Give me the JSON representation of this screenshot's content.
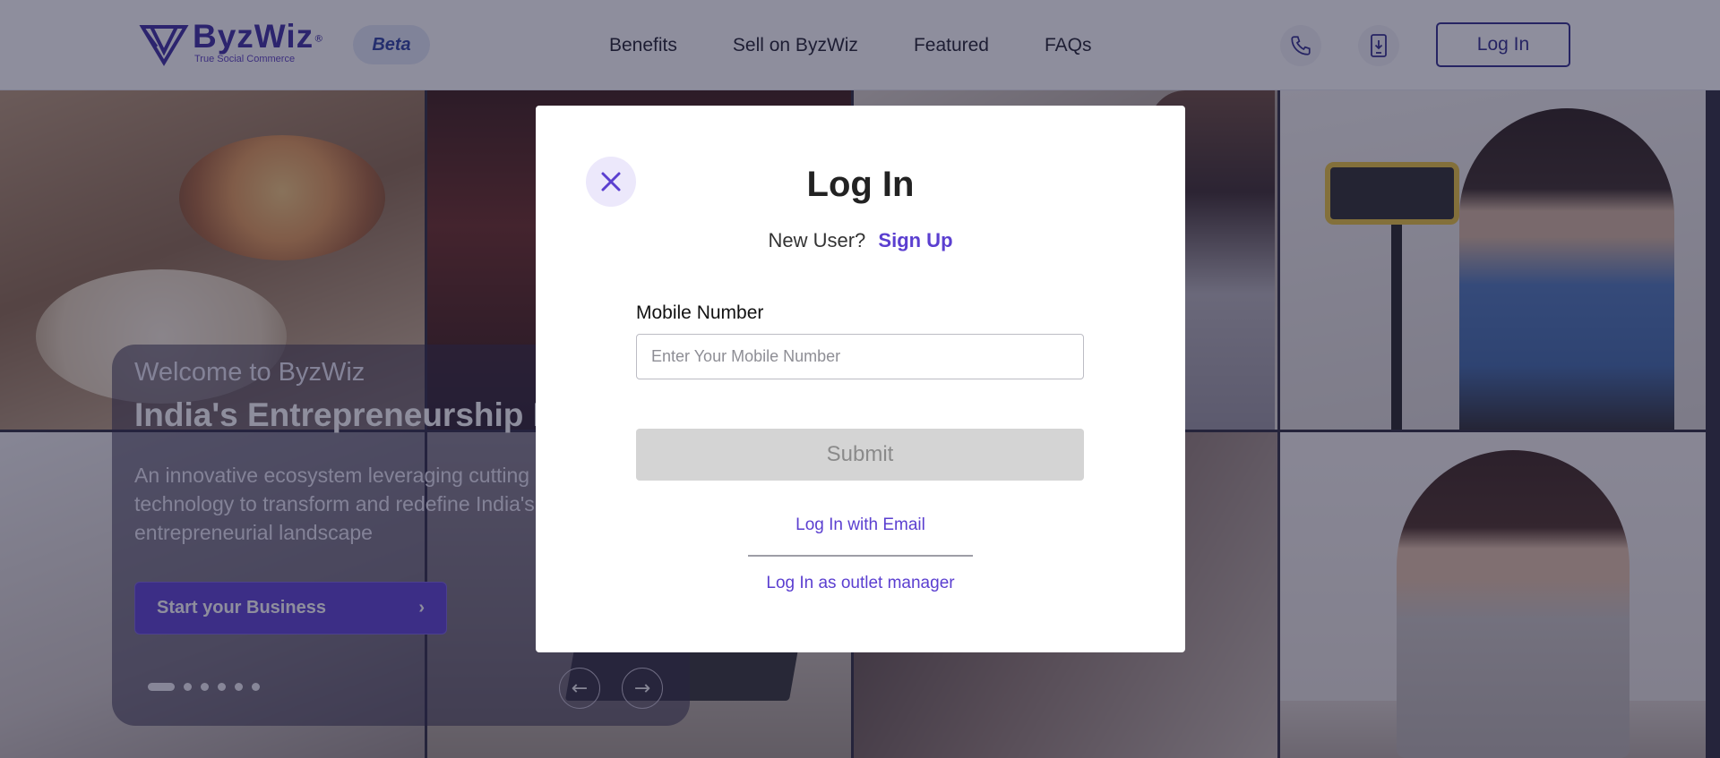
{
  "header": {
    "logo_name": "ByzWiz",
    "logo_reg": "®",
    "logo_tagline": "True Social Commerce",
    "beta_label": "Beta",
    "nav": [
      "Benefits",
      "Sell on ByzWiz",
      "Featured",
      "FAQs"
    ],
    "phone_icon": "phone-icon",
    "app_icon": "mobile-download-icon",
    "login_label": "Log In"
  },
  "hero": {
    "welcome": "Welcome to ByzWiz",
    "title": "India's Entrepreneurship I",
    "description": "An innovative ecosystem leveraging cutting technology to transform and redefine India's entrepreneurial landscape",
    "cta_label": "Start your Business",
    "cta_icon": "chevron-right-icon",
    "slide_count": 6,
    "active_slide": 1,
    "prev_icon": "arrow-left-icon",
    "next_icon": "arrow-right-icon"
  },
  "modal": {
    "close_icon": "close-icon",
    "title": "Log In",
    "new_user_text": "New User?",
    "signup_label": "Sign Up",
    "mobile_label": "Mobile Number",
    "mobile_placeholder": "Enter Your Mobile Number",
    "mobile_value": "",
    "submit_label": "Submit",
    "email_login_label": "Log In with Email",
    "outlet_login_label": "Log In as outlet manager"
  },
  "colors": {
    "brand_purple": "#5b3fd0",
    "brand_dark": "#2f2a8a",
    "overlay": "rgba(30,30,60,0.5)",
    "submit_disabled": "#d4d4d4"
  }
}
